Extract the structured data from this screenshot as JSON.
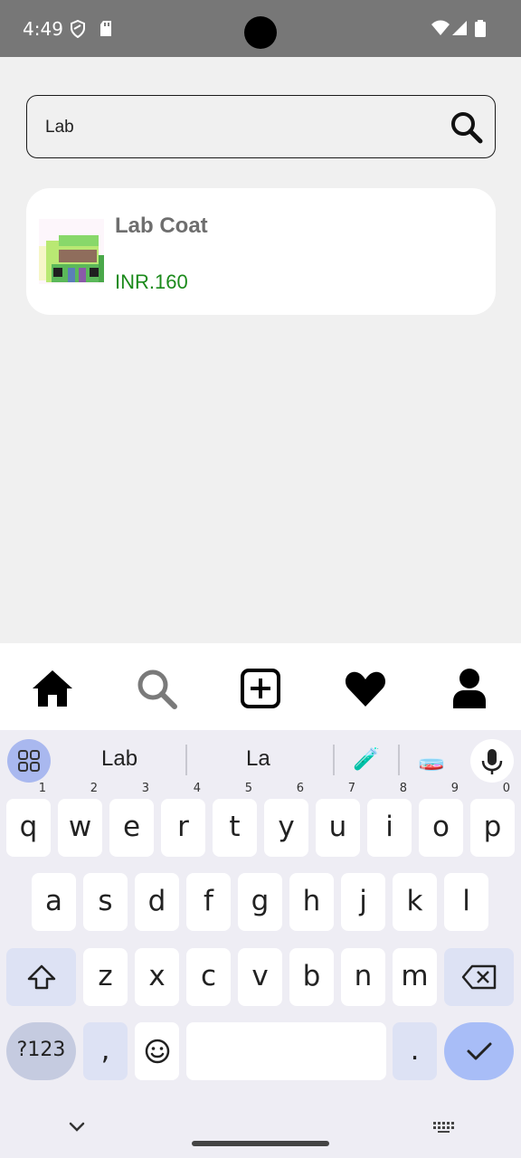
{
  "status_bar": {
    "time": "4:49",
    "icons": [
      "shield-icon",
      "sd-card-icon",
      "wifi-icon",
      "signal-icon",
      "battery-icon"
    ]
  },
  "search": {
    "value": "Lab",
    "icon": "search-icon"
  },
  "results": [
    {
      "name": "Lab Coat",
      "price": "INR.160",
      "icon": "product-thumbnail"
    }
  ],
  "bottom_nav": [
    "home-icon",
    "search-icon",
    "add-post-icon",
    "favorite-icon",
    "profile-icon"
  ],
  "keyboard": {
    "suggestions": [
      "Lab",
      "La",
      "🧪",
      "🧫"
    ],
    "row1": [
      {
        "key": "q",
        "hint": "1"
      },
      {
        "key": "w",
        "hint": "2"
      },
      {
        "key": "e",
        "hint": "3"
      },
      {
        "key": "r",
        "hint": "4"
      },
      {
        "key": "t",
        "hint": "5"
      },
      {
        "key": "y",
        "hint": "6"
      },
      {
        "key": "u",
        "hint": "7"
      },
      {
        "key": "i",
        "hint": "8"
      },
      {
        "key": "o",
        "hint": "9"
      },
      {
        "key": "p",
        "hint": "0"
      }
    ],
    "row2": [
      "a",
      "s",
      "d",
      "f",
      "g",
      "h",
      "j",
      "k",
      "l"
    ],
    "row3": [
      "z",
      "x",
      "c",
      "v",
      "b",
      "n",
      "m"
    ],
    "symbols_label": "?123",
    "comma": ",",
    "period": "."
  },
  "colors": {
    "accent_price": "#1b8a1b",
    "keyboard_accent": "#a8bdf7",
    "status_bar": "#777777"
  }
}
